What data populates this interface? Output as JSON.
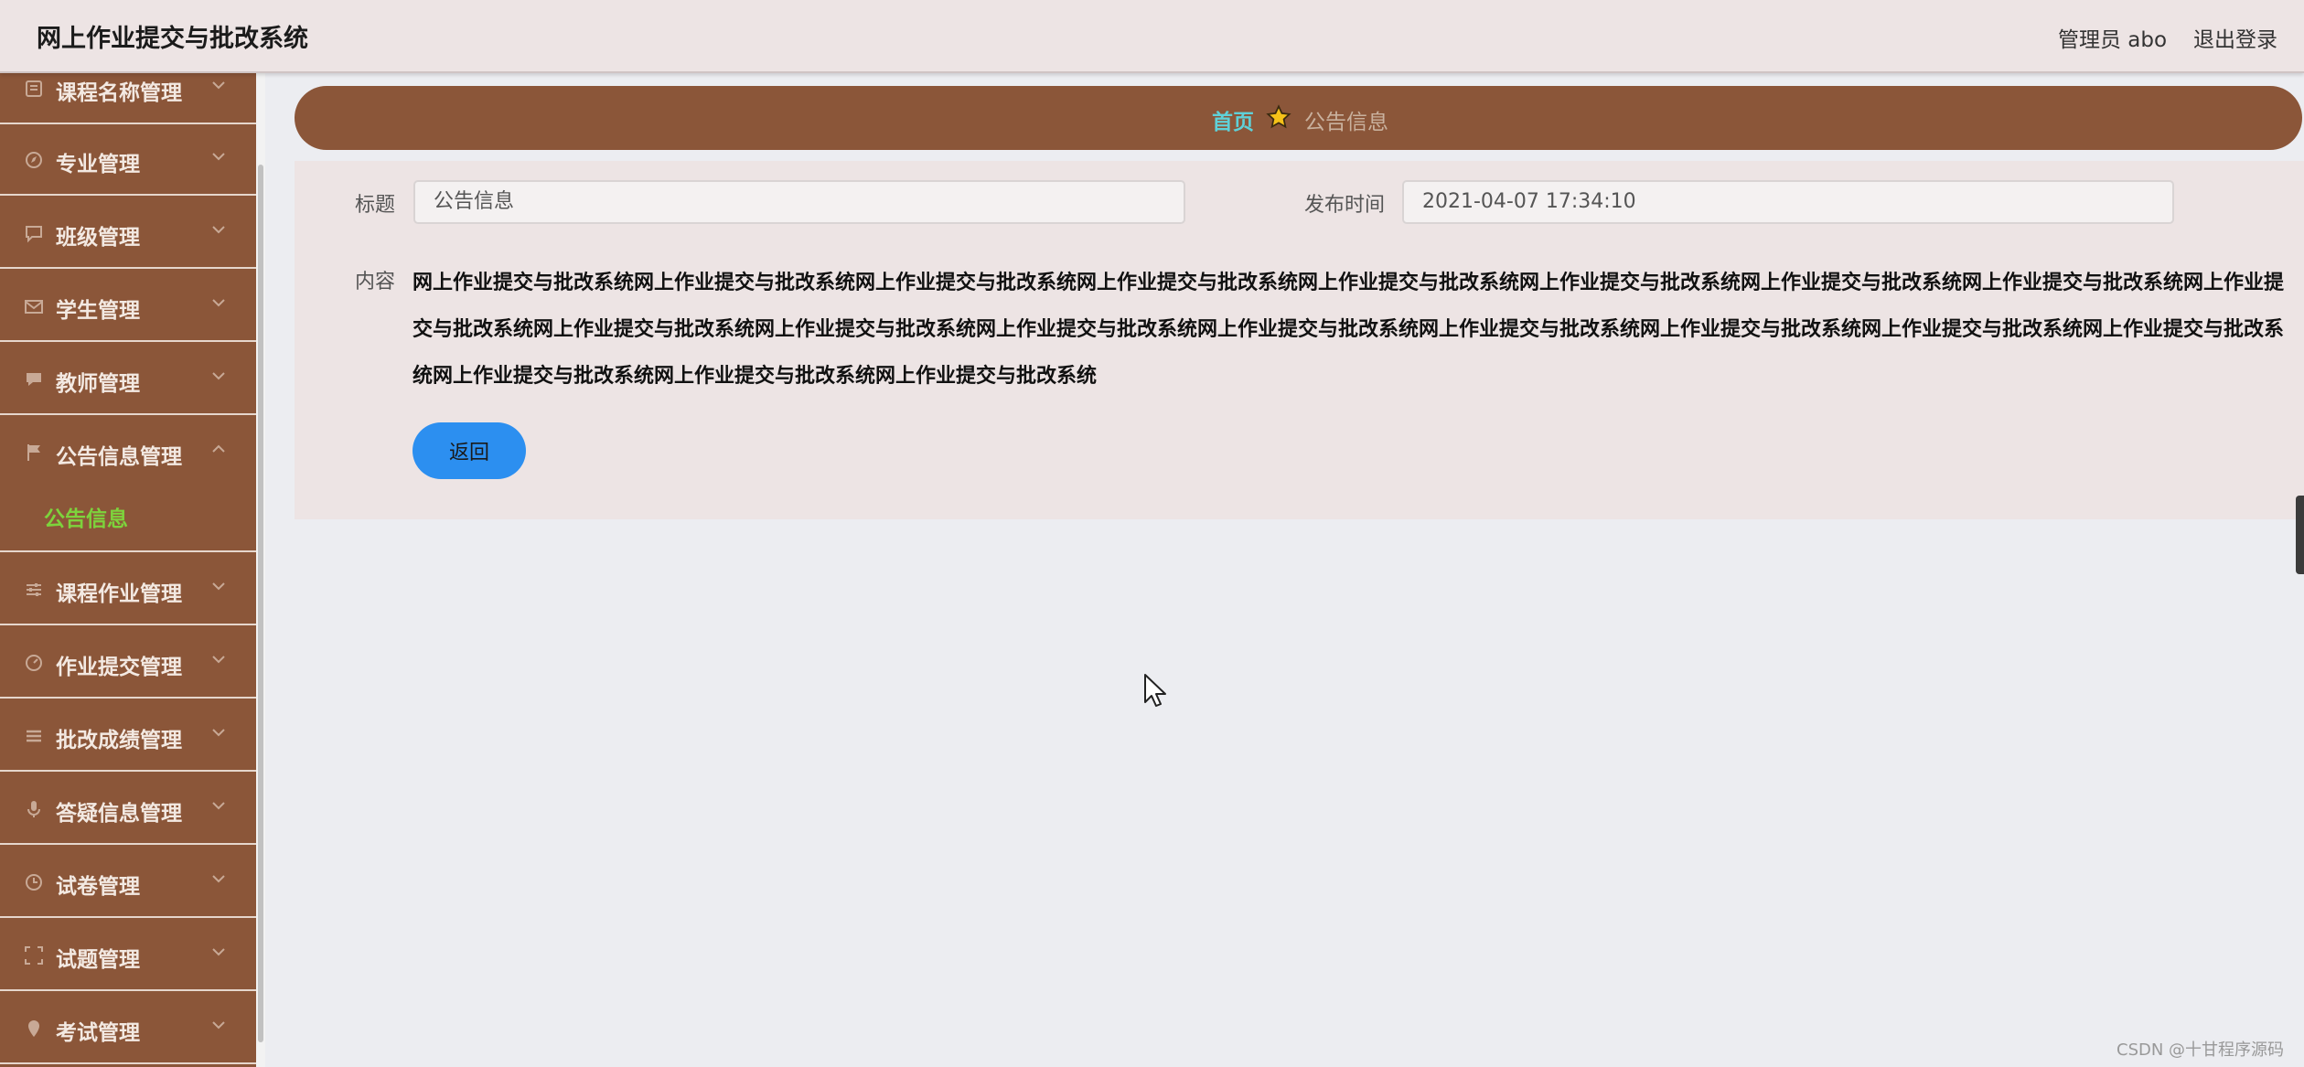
{
  "header": {
    "app_title": "网上作业提交与批改系统",
    "user_label": "管理员 abo",
    "logout_label": "退出登录"
  },
  "sidebar": {
    "items": [
      {
        "label": "课程名称管理",
        "icon": "book-icon"
      },
      {
        "label": "专业管理",
        "icon": "compass-icon"
      },
      {
        "label": "班级管理",
        "icon": "chat-icon"
      },
      {
        "label": "学生管理",
        "icon": "mail-icon"
      },
      {
        "label": "教师管理",
        "icon": "comment-icon"
      },
      {
        "label": "公告信息管理",
        "icon": "flag-icon",
        "expanded": true,
        "sub_items": [
          "公告信息"
        ]
      },
      {
        "label": "课程作业管理",
        "icon": "sliders-icon"
      },
      {
        "label": "作业提交管理",
        "icon": "gauge-icon"
      },
      {
        "label": "批改成绩管理",
        "icon": "list-icon"
      },
      {
        "label": "答疑信息管理",
        "icon": "microphone-icon"
      },
      {
        "label": "试卷管理",
        "icon": "clock-icon"
      },
      {
        "label": "试题管理",
        "icon": "frame-icon"
      },
      {
        "label": "考试管理",
        "icon": "pin-icon"
      }
    ]
  },
  "breadcrumb": {
    "home": "首页",
    "current": "公告信息"
  },
  "form": {
    "title_label": "标题",
    "title_value": "公告信息",
    "time_label": "发布时间",
    "time_value": "2021-04-07 17:34:10",
    "content_label": "内容",
    "content_value": "网上作业提交与批改系统网上作业提交与批改系统网上作业提交与批改系统网上作业提交与批改系统网上作业提交与批改系统网上作业提交与批改系统网上作业提交与批改系统网上作业提交与批改系统网上作业提交与批改系统网上作业提交与批改系统网上作业提交与批改系统网上作业提交与批改系统网上作业提交与批改系统网上作业提交与批改系统网上作业提交与批改系统网上作业提交与批改系统网上作业提交与批改系统网上作业提交与批改系统网上作业提交与批改系统网上作业提交与批改系统",
    "back_label": "返回"
  },
  "watermark": "CSDN @十甘程序源码",
  "colors": {
    "sidebar_bg": "#8b5639",
    "accent_green": "#7dd33c",
    "accent_cyan": "#5fd1d8",
    "button_blue": "#2c8ff0"
  }
}
